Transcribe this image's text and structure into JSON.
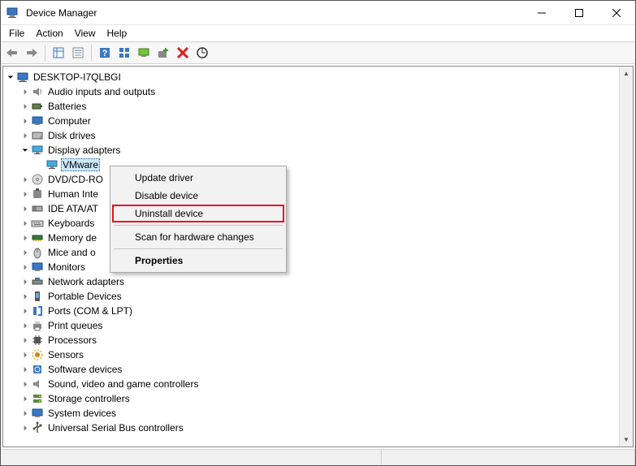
{
  "window": {
    "title": "Device Manager"
  },
  "menu": {
    "items": [
      "File",
      "Action",
      "View",
      "Help"
    ]
  },
  "toolbar": {
    "back": "back-arrow",
    "forward": "forward-arrow",
    "show_hidden": "show-hidden",
    "properties": "properties",
    "help": "help",
    "tiles": "tiles",
    "computer": "computer",
    "add_hardware": "add-hardware",
    "remove": "remove",
    "scan": "scan-hardware"
  },
  "tree": {
    "root": {
      "label": "DESKTOP-I7QLBGI",
      "expanded": true
    },
    "nodes": [
      {
        "label": "Audio inputs and outputs",
        "icon": "audio-icon",
        "expanded": false
      },
      {
        "label": "Batteries",
        "icon": "battery-icon",
        "expanded": false
      },
      {
        "label": "Computer",
        "icon": "computer-icon",
        "expanded": false
      },
      {
        "label": "Disk drives",
        "icon": "disk-icon",
        "expanded": false
      },
      {
        "label": "Display adapters",
        "icon": "display-icon",
        "expanded": true,
        "children": [
          {
            "label": "VMware",
            "icon": "display-icon",
            "selected": true
          }
        ]
      },
      {
        "label": "DVD/CD-RO",
        "icon": "dvd-icon",
        "expanded": false,
        "truncated": true
      },
      {
        "label": "Human Inte",
        "icon": "hid-icon",
        "expanded": false,
        "truncated": true
      },
      {
        "label": "IDE ATA/AT",
        "icon": "ide-icon",
        "expanded": false,
        "truncated": true
      },
      {
        "label": "Keyboards",
        "icon": "keyboard-icon",
        "expanded": false
      },
      {
        "label": "Memory de",
        "icon": "memory-icon",
        "expanded": false,
        "truncated": true
      },
      {
        "label": "Mice and o",
        "icon": "mouse-icon",
        "expanded": false,
        "truncated": true
      },
      {
        "label": "Monitors",
        "icon": "monitor-icon",
        "expanded": false
      },
      {
        "label": "Network adapters",
        "icon": "network-icon",
        "expanded": false
      },
      {
        "label": "Portable Devices",
        "icon": "portable-icon",
        "expanded": false
      },
      {
        "label": "Ports (COM & LPT)",
        "icon": "port-icon",
        "expanded": false
      },
      {
        "label": "Print queues",
        "icon": "printer-icon",
        "expanded": false
      },
      {
        "label": "Processors",
        "icon": "cpu-icon",
        "expanded": false
      },
      {
        "label": "Sensors",
        "icon": "sensor-icon",
        "expanded": false
      },
      {
        "label": "Software devices",
        "icon": "software-icon",
        "expanded": false
      },
      {
        "label": "Sound, video and game controllers",
        "icon": "sound-icon",
        "expanded": false
      },
      {
        "label": "Storage controllers",
        "icon": "storage-icon",
        "expanded": false
      },
      {
        "label": "System devices",
        "icon": "system-icon",
        "expanded": false
      },
      {
        "label": "Universal Serial Bus controllers",
        "icon": "usb-icon",
        "expanded": false
      }
    ]
  },
  "context_menu": {
    "items": [
      {
        "label": "Update driver",
        "type": "item"
      },
      {
        "label": "Disable device",
        "type": "item"
      },
      {
        "label": "Uninstall device",
        "type": "item",
        "highlight": true
      },
      {
        "type": "sep"
      },
      {
        "label": "Scan for hardware changes",
        "type": "item"
      },
      {
        "type": "sep"
      },
      {
        "label": "Properties",
        "type": "item",
        "bold": true
      }
    ]
  }
}
